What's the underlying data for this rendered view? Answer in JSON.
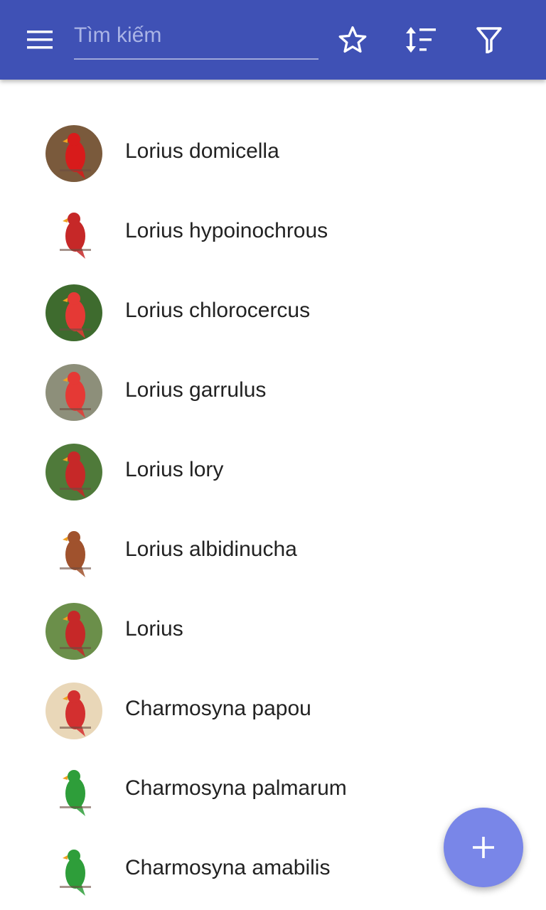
{
  "app_bar": {
    "background": "#3f51b5",
    "menu_icon": "hamburger-menu-icon",
    "search": {
      "placeholder": "Tìm kiếm",
      "value": ""
    },
    "favorites_icon": "star-outline-icon",
    "sort_icon": "sort-icon",
    "filter_icon": "filter-icon"
  },
  "list": {
    "items": [
      {
        "label": "Lorius domicella",
        "thumb_bg": "#7a5a3c",
        "bird_color": "#d81b1b"
      },
      {
        "label": "Lorius hypoinochrous",
        "thumb_bg": "#ffffff",
        "bird_color": "#c62828"
      },
      {
        "label": "Lorius chlorocercus",
        "thumb_bg": "#3e6b2e",
        "bird_color": "#e53935"
      },
      {
        "label": "Lorius garrulus",
        "thumb_bg": "#8d8f7a",
        "bird_color": "#e53935"
      },
      {
        "label": "Lorius lory",
        "thumb_bg": "#4f7a3a",
        "bird_color": "#c62828"
      },
      {
        "label": "Lorius albidinucha",
        "thumb_bg": "#ffffff",
        "bird_color": "#a0522d"
      },
      {
        "label": "Lorius",
        "thumb_bg": "#6b8f4a",
        "bird_color": "#c62828"
      },
      {
        "label": "Charmosyna papou",
        "thumb_bg": "#e9d7b8",
        "bird_color": "#d32f2f"
      },
      {
        "label": "Charmosyna palmarum",
        "thumb_bg": "#ffffff",
        "bird_color": "#2e9e3a"
      },
      {
        "label": "Charmosyna amabilis",
        "thumb_bg": "#ffffff",
        "bird_color": "#2e9e3a"
      }
    ]
  },
  "fab": {
    "icon": "plus-icon",
    "color": "#7986e8"
  }
}
